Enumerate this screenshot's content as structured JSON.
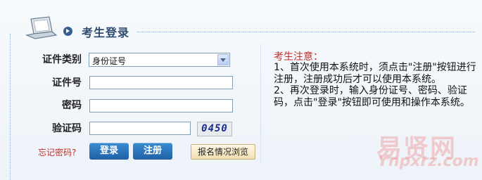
{
  "header": {
    "title": "考生登录"
  },
  "form": {
    "id_type_label": "证件类别",
    "id_type_value": "身份证号",
    "id_number_label": "证件号",
    "password_label": "密码",
    "captcha_label": "验证码",
    "captcha_text": "0450",
    "forgot_link": "忘记密码?",
    "login_button": "登录",
    "register_button": "注册",
    "browse_button": "报名情况浏览"
  },
  "notice": {
    "title": "考生注意：",
    "item1": "1、首次使用本系统时，须点击\"注册\"按钮进行注册，注册成功后才可以使用本系统。",
    "item2": "2、再次登录时，输入身份证号、密码、验证码，点击\"登录\"按钮即可使用和操作本系统。"
  },
  "watermark": {
    "text": "易贤网",
    "url_text": "Ynpxrz.com"
  },
  "colors": {
    "accent": "#1f5fa5",
    "notice_title": "#c0302b",
    "forgot_link": "#c0302b"
  }
}
